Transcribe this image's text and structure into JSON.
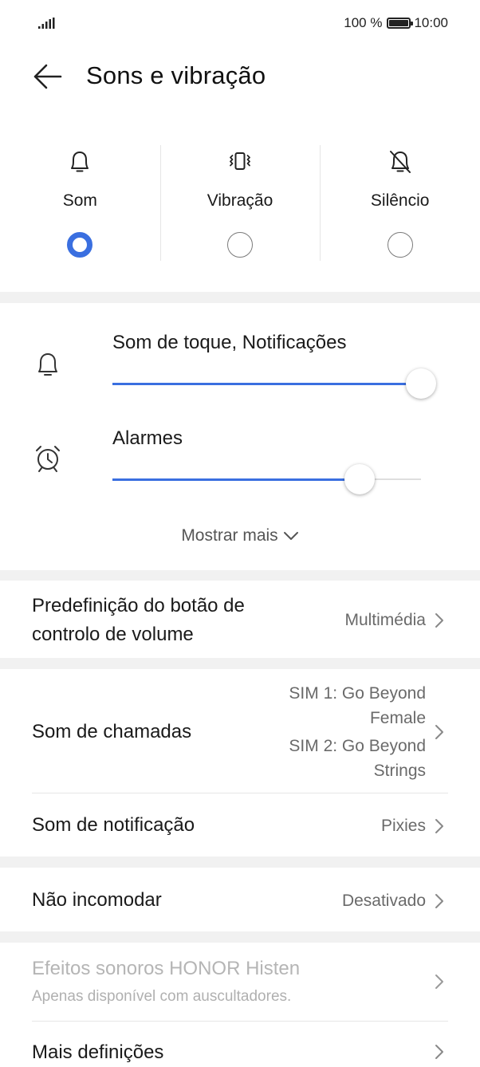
{
  "status_bar": {
    "battery_percent": "100 %",
    "time": "10:00"
  },
  "header": {
    "title": "Sons e vibração"
  },
  "modes": [
    {
      "label": "Som",
      "icon": "bell-icon",
      "selected": true
    },
    {
      "label": "Vibração",
      "icon": "vibrate-icon",
      "selected": false
    },
    {
      "label": "Silêncio",
      "icon": "bell-off-icon",
      "selected": false
    }
  ],
  "volume": {
    "ringtone": {
      "label": "Som de toque, Notificações",
      "level": 1.0
    },
    "alarms": {
      "label": "Alarmes",
      "level": 0.8
    },
    "show_more": "Mostrar mais"
  },
  "volume_button": {
    "title_line1": "Predefinição do botão de",
    "title_line2": "controlo de volume",
    "value": "Multimédia"
  },
  "call_sound": {
    "title": "Som de chamadas",
    "sim1_line1": "SIM 1: Go Beyond",
    "sim1_line2": "Female",
    "sim2_line1": "SIM 2: Go Beyond",
    "sim2_line2": "Strings"
  },
  "notification_sound": {
    "title": "Som de notificação",
    "value": "Pixies"
  },
  "dnd": {
    "title": "Não incomodar",
    "value": "Desativado"
  },
  "histen": {
    "title": "Efeitos sonoros HONOR Histen",
    "subtitle": "Apenas disponível com auscultadores."
  },
  "more_settings": {
    "title": "Mais definições"
  },
  "colors": {
    "accent": "#3a6fe0",
    "separator": "#f1f1f1"
  }
}
